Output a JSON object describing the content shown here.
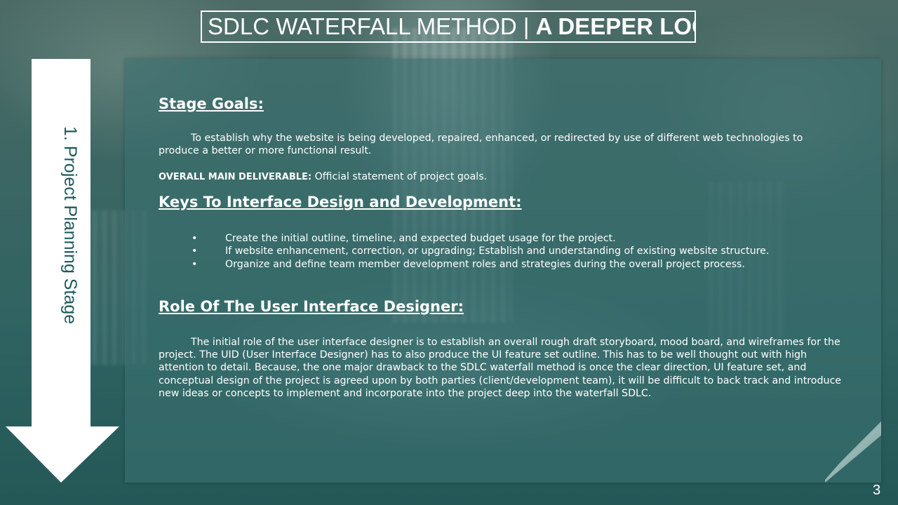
{
  "slide": {
    "title_main": "SDLC WATERFALL METHOD | ",
    "title_bold": "A DEEPER LOOK",
    "stage_label": "1.  Project Planning Stage",
    "page_number": "3"
  },
  "sections": {
    "goals_heading": "Stage Goals:",
    "goals_text": "To establish why the website is being developed, repaired, enhanced, or redirected by use of different web technologies to produce a better or more functional result.",
    "deliverable_label": "OVERALL MAIN DELIVERABLE:",
    "deliverable_text": " Official statement of project goals.",
    "keys_heading": "Keys To Interface Design and Development:",
    "keys_items": [
      "Create the initial outline, timeline, and expected budget usage for the project.",
      "If website enhancement, correction, or upgrading; Establish and understanding of existing website structure.",
      "Organize and define team member development roles and strategies during the overall project process."
    ],
    "bullet_glyph": "•",
    "role_heading": "Role Of The User Interface Designer:",
    "role_text": "The initial role of the user interface designer is to establish an overall rough draft storyboard, mood board, and wireframes for the project. The UID (User Interface Designer) has to also produce the UI feature set outline. This has to be well thought out with high attention to detail. Because, the one major drawback to the SDLC waterfall method is once the clear direction, UI feature set, and conceptual design of the project is agreed upon by both parties (client/development team), it will be difficult to back track and introduce new ideas or concepts to implement and incorporate into the project deep into the waterfall SDLC."
  },
  "colors": {
    "panel": "#3a7070",
    "arrow": "#ffffff",
    "arrow_text": "#1f5a5c"
  }
}
